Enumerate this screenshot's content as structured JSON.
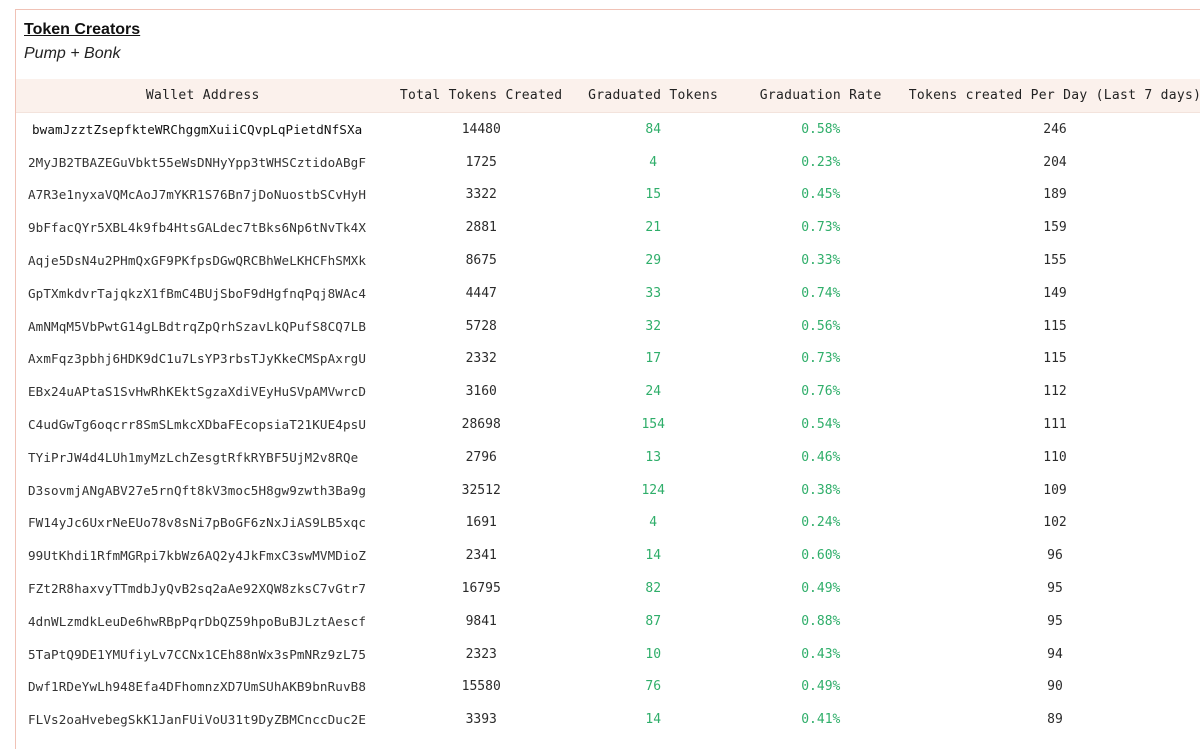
{
  "header": {
    "title": "Token Creators",
    "subtitle": "Pump + Bonk"
  },
  "table": {
    "columns": [
      "Wallet Address",
      "Total Tokens Created",
      "Graduated Tokens",
      "Graduation Rate",
      "Tokens created Per Day (Last 7 days)"
    ],
    "rows": [
      {
        "wallet": "bwamJzztZsepfkteWRChggmXuiiCQvpLqPietdNfSXa",
        "total": "14480",
        "graduated": "84",
        "rate": "0.58%",
        "per_day": "246"
      },
      {
        "wallet": "2MyJB2TBAZEGuVbkt55eWsDNHyYpp3tWHSCztidoABgF",
        "total": "1725",
        "graduated": "4",
        "rate": "0.23%",
        "per_day": "204"
      },
      {
        "wallet": "A7R3e1nyxaVQMcAoJ7mYKR1S76Bn7jDoNuostbSCvHyH",
        "total": "3322",
        "graduated": "15",
        "rate": "0.45%",
        "per_day": "189"
      },
      {
        "wallet": "9bFfacQYr5XBL4k9fb4HtsGALdec7tBks6Np6tNvTk4X",
        "total": "2881",
        "graduated": "21",
        "rate": "0.73%",
        "per_day": "159"
      },
      {
        "wallet": "Aqje5DsN4u2PHmQxGF9PKfpsDGwQRCBhWeLKHCFhSMXk",
        "total": "8675",
        "graduated": "29",
        "rate": "0.33%",
        "per_day": "155"
      },
      {
        "wallet": "GpTXmkdvrTajqkzX1fBmC4BUjSboF9dHgfnqPqj8WAc4",
        "total": "4447",
        "graduated": "33",
        "rate": "0.74%",
        "per_day": "149"
      },
      {
        "wallet": "AmNMqM5VbPwtG14gLBdtrqZpQrhSzavLkQPufS8CQ7LB",
        "total": "5728",
        "graduated": "32",
        "rate": "0.56%",
        "per_day": "115"
      },
      {
        "wallet": "AxmFqz3pbhj6HDK9dC1u7LsYP3rbsTJyKkeCMSpAxrgU",
        "total": "2332",
        "graduated": "17",
        "rate": "0.73%",
        "per_day": "115"
      },
      {
        "wallet": "EBx24uAPtaS1SvHwRhKEktSgzaXdiVEyHuSVpAMVwrcD",
        "total": "3160",
        "graduated": "24",
        "rate": "0.76%",
        "per_day": "112"
      },
      {
        "wallet": "C4udGwTg6oqcrr8SmSLmkcXDbaFEcopsiaT21KUE4psU",
        "total": "28698",
        "graduated": "154",
        "rate": "0.54%",
        "per_day": "111"
      },
      {
        "wallet": "TYiPrJW4d4LUh1myMzLchZesgtRfkRYBF5UjM2v8RQe",
        "total": "2796",
        "graduated": "13",
        "rate": "0.46%",
        "per_day": "110"
      },
      {
        "wallet": "D3sovmjANgABV27e5rnQft8kV3moc5H8gw9zwth3Ba9g",
        "total": "32512",
        "graduated": "124",
        "rate": "0.38%",
        "per_day": "109"
      },
      {
        "wallet": "FW14yJc6UxrNeEUo78v8sNi7pBoGF6zNxJiAS9LB5xqc",
        "total": "1691",
        "graduated": "4",
        "rate": "0.24%",
        "per_day": "102"
      },
      {
        "wallet": "99UtKhdi1RfmMGRpi7kbWz6AQ2y4JkFmxC3swMVMDioZ",
        "total": "2341",
        "graduated": "14",
        "rate": "0.60%",
        "per_day": "96"
      },
      {
        "wallet": "FZt2R8haxvyTTmdbJyQvB2sq2aAe92XQW8zksC7vGtr7",
        "total": "16795",
        "graduated": "82",
        "rate": "0.49%",
        "per_day": "95"
      },
      {
        "wallet": "4dnWLzmdkLeuDe6hwRBpPqrDbQZ59hpoBuBJLztAescf",
        "total": "9841",
        "graduated": "87",
        "rate": "0.88%",
        "per_day": "95"
      },
      {
        "wallet": "5TaPtQ9DE1YMUfiyLv7CCNx1CEh88nWx3sPmNRz9zL75",
        "total": "2323",
        "graduated": "10",
        "rate": "0.43%",
        "per_day": "94"
      },
      {
        "wallet": "Dwf1RDeYwLh948Efa4DFhomnzXD7UmSUhAKB9bnRuvB8",
        "total": "15580",
        "graduated": "76",
        "rate": "0.49%",
        "per_day": "90"
      },
      {
        "wallet": "FLVs2oaHvebegSkK1JanFUiVoU31t9DyZBMCnccDuc2E",
        "total": "3393",
        "graduated": "14",
        "rate": "0.41%",
        "per_day": "89"
      }
    ]
  },
  "colors": {
    "accent_green": "#2fae6a",
    "header_bg": "#fbf1ec",
    "border": "#f0c2b6"
  }
}
